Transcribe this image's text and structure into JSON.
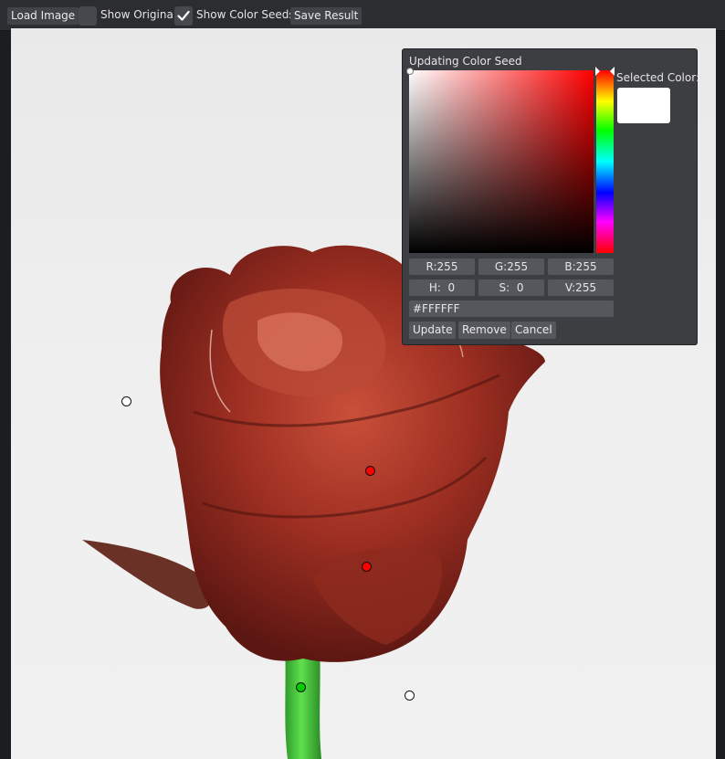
{
  "toolbar": {
    "load_image": "Load Image",
    "show_original": {
      "label": "Show Original",
      "checked": false
    },
    "show_color_seeds": {
      "label": "Show Color Seeds",
      "checked": true
    },
    "save_result": "Save Result"
  },
  "seeds": [
    {
      "name": "seed-background-left",
      "color": "#ffffff"
    },
    {
      "name": "seed-petal-upper",
      "color": "#ff0000"
    },
    {
      "name": "seed-petal-lower",
      "color": "#ff0000"
    },
    {
      "name": "seed-stem",
      "color": "#00cc00"
    },
    {
      "name": "seed-background-bottom",
      "color": "#ffffff"
    }
  ],
  "color_dialog": {
    "title": "Updating Color Seed",
    "selected_color_label": "Selected Color:",
    "selected_color": "#ffffff",
    "r": "R:255",
    "g": "G:255",
    "b": "B:255",
    "h": "H:  0",
    "s": "S:  0",
    "v": "V:255",
    "hex": "#FFFFFF",
    "update": "Update",
    "remove": "Remove",
    "cancel": "Cancel"
  }
}
